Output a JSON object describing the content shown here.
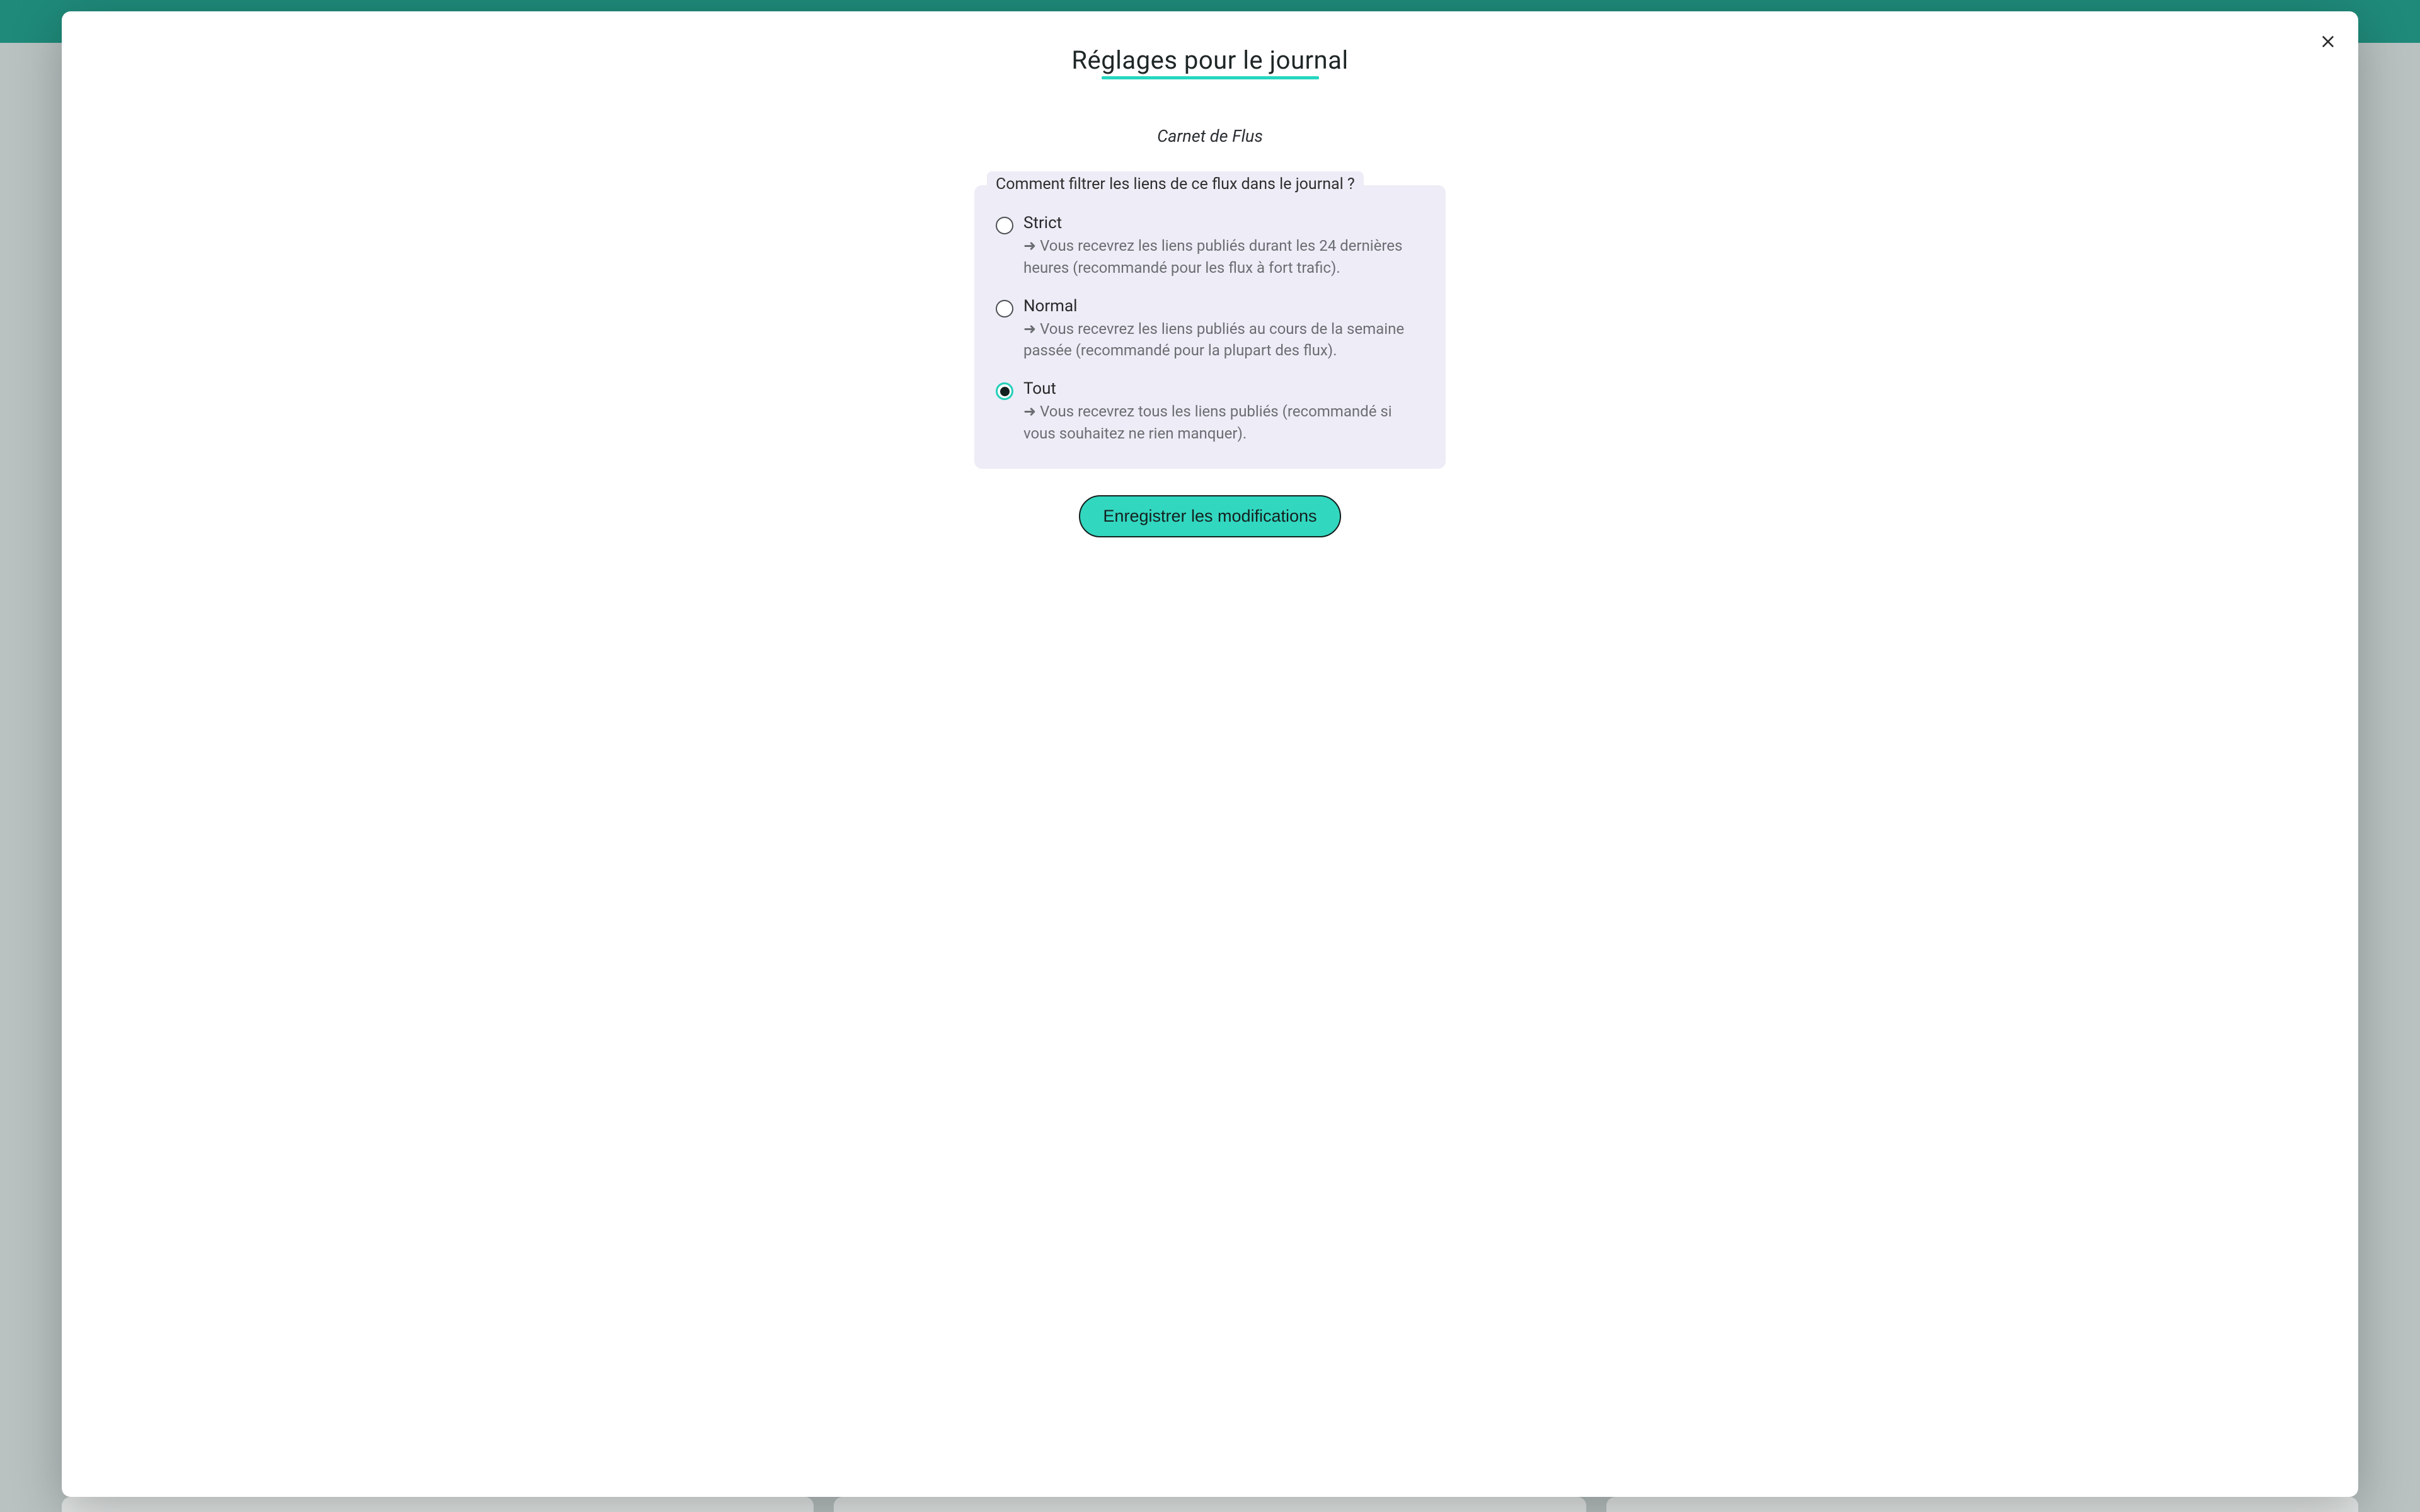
{
  "modal": {
    "title": "Réglages pour le journal",
    "subtitle": "Carnet de Flus",
    "legend": "Comment filtrer les liens de ce flux dans le journal ?",
    "options": [
      {
        "label": "Strict",
        "description": "Vous recevrez les liens publiés durant les 24 dernières heures (recommandé pour les flux à fort trafic).",
        "checked": false
      },
      {
        "label": "Normal",
        "description": "Vous recevrez les liens publiés au cours de la semaine passée (recommandé pour la plupart des flux).",
        "checked": false
      },
      {
        "label": "Tout",
        "description": "Vous recevrez tous les liens publiés (recommandé si vous souhaitez ne rien manquer).",
        "checked": true
      }
    ],
    "submit_label": "Enregistrer les modifications"
  },
  "arrow_glyph": "➜"
}
